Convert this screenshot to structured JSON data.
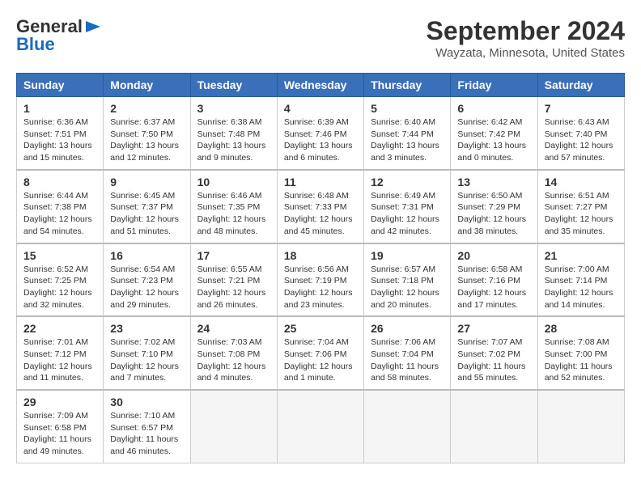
{
  "header": {
    "logo_general": "General",
    "logo_blue": "Blue",
    "title": "September 2024",
    "subtitle": "Wayzata, Minnesota, United States"
  },
  "columns": [
    "Sunday",
    "Monday",
    "Tuesday",
    "Wednesday",
    "Thursday",
    "Friday",
    "Saturday"
  ],
  "weeks": [
    [
      {
        "day": "1",
        "info": "Sunrise: 6:36 AM\nSunset: 7:51 PM\nDaylight: 13 hours\nand 15 minutes."
      },
      {
        "day": "2",
        "info": "Sunrise: 6:37 AM\nSunset: 7:50 PM\nDaylight: 13 hours\nand 12 minutes."
      },
      {
        "day": "3",
        "info": "Sunrise: 6:38 AM\nSunset: 7:48 PM\nDaylight: 13 hours\nand 9 minutes."
      },
      {
        "day": "4",
        "info": "Sunrise: 6:39 AM\nSunset: 7:46 PM\nDaylight: 13 hours\nand 6 minutes."
      },
      {
        "day": "5",
        "info": "Sunrise: 6:40 AM\nSunset: 7:44 PM\nDaylight: 13 hours\nand 3 minutes."
      },
      {
        "day": "6",
        "info": "Sunrise: 6:42 AM\nSunset: 7:42 PM\nDaylight: 13 hours\nand 0 minutes."
      },
      {
        "day": "7",
        "info": "Sunrise: 6:43 AM\nSunset: 7:40 PM\nDaylight: 12 hours\nand 57 minutes."
      }
    ],
    [
      {
        "day": "8",
        "info": "Sunrise: 6:44 AM\nSunset: 7:38 PM\nDaylight: 12 hours\nand 54 minutes."
      },
      {
        "day": "9",
        "info": "Sunrise: 6:45 AM\nSunset: 7:37 PM\nDaylight: 12 hours\nand 51 minutes."
      },
      {
        "day": "10",
        "info": "Sunrise: 6:46 AM\nSunset: 7:35 PM\nDaylight: 12 hours\nand 48 minutes."
      },
      {
        "day": "11",
        "info": "Sunrise: 6:48 AM\nSunset: 7:33 PM\nDaylight: 12 hours\nand 45 minutes."
      },
      {
        "day": "12",
        "info": "Sunrise: 6:49 AM\nSunset: 7:31 PM\nDaylight: 12 hours\nand 42 minutes."
      },
      {
        "day": "13",
        "info": "Sunrise: 6:50 AM\nSunset: 7:29 PM\nDaylight: 12 hours\nand 38 minutes."
      },
      {
        "day": "14",
        "info": "Sunrise: 6:51 AM\nSunset: 7:27 PM\nDaylight: 12 hours\nand 35 minutes."
      }
    ],
    [
      {
        "day": "15",
        "info": "Sunrise: 6:52 AM\nSunset: 7:25 PM\nDaylight: 12 hours\nand 32 minutes."
      },
      {
        "day": "16",
        "info": "Sunrise: 6:54 AM\nSunset: 7:23 PM\nDaylight: 12 hours\nand 29 minutes."
      },
      {
        "day": "17",
        "info": "Sunrise: 6:55 AM\nSunset: 7:21 PM\nDaylight: 12 hours\nand 26 minutes."
      },
      {
        "day": "18",
        "info": "Sunrise: 6:56 AM\nSunset: 7:19 PM\nDaylight: 12 hours\nand 23 minutes."
      },
      {
        "day": "19",
        "info": "Sunrise: 6:57 AM\nSunset: 7:18 PM\nDaylight: 12 hours\nand 20 minutes."
      },
      {
        "day": "20",
        "info": "Sunrise: 6:58 AM\nSunset: 7:16 PM\nDaylight: 12 hours\nand 17 minutes."
      },
      {
        "day": "21",
        "info": "Sunrise: 7:00 AM\nSunset: 7:14 PM\nDaylight: 12 hours\nand 14 minutes."
      }
    ],
    [
      {
        "day": "22",
        "info": "Sunrise: 7:01 AM\nSunset: 7:12 PM\nDaylight: 12 hours\nand 11 minutes."
      },
      {
        "day": "23",
        "info": "Sunrise: 7:02 AM\nSunset: 7:10 PM\nDaylight: 12 hours\nand 7 minutes."
      },
      {
        "day": "24",
        "info": "Sunrise: 7:03 AM\nSunset: 7:08 PM\nDaylight: 12 hours\nand 4 minutes."
      },
      {
        "day": "25",
        "info": "Sunrise: 7:04 AM\nSunset: 7:06 PM\nDaylight: 12 hours\nand 1 minute."
      },
      {
        "day": "26",
        "info": "Sunrise: 7:06 AM\nSunset: 7:04 PM\nDaylight: 11 hours\nand 58 minutes."
      },
      {
        "day": "27",
        "info": "Sunrise: 7:07 AM\nSunset: 7:02 PM\nDaylight: 11 hours\nand 55 minutes."
      },
      {
        "day": "28",
        "info": "Sunrise: 7:08 AM\nSunset: 7:00 PM\nDaylight: 11 hours\nand 52 minutes."
      }
    ],
    [
      {
        "day": "29",
        "info": "Sunrise: 7:09 AM\nSunset: 6:58 PM\nDaylight: 11 hours\nand 49 minutes."
      },
      {
        "day": "30",
        "info": "Sunrise: 7:10 AM\nSunset: 6:57 PM\nDaylight: 11 hours\nand 46 minutes."
      },
      {
        "day": "",
        "info": ""
      },
      {
        "day": "",
        "info": ""
      },
      {
        "day": "",
        "info": ""
      },
      {
        "day": "",
        "info": ""
      },
      {
        "day": "",
        "info": ""
      }
    ]
  ]
}
